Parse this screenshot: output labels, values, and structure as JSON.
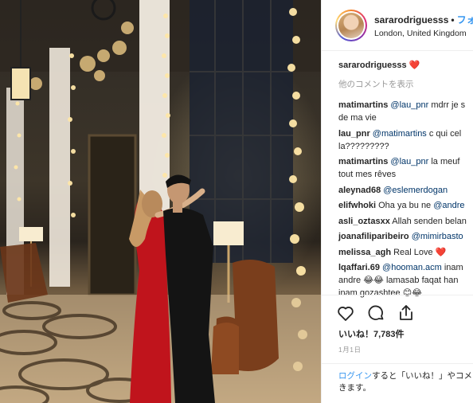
{
  "header": {
    "username": "sararodriguesss",
    "separator": "•",
    "follow_label": "フォ",
    "location": "London, United Kingdom"
  },
  "caption": {
    "username": "sararodriguesss",
    "text": "❤️"
  },
  "view_more_label": "他のコメントを表示",
  "comments": [
    {
      "username": "matimartins",
      "mention": "@lau_pnr",
      "text": " mdrr je s",
      "text2": "de ma vie"
    },
    {
      "username": "lau_pnr",
      "mention": "@matimartins",
      "text": " c qui cel",
      "text2": "la?????????"
    },
    {
      "username": "matimartins",
      "mention": "@lau_pnr",
      "text": " la meuf ",
      "text2": "tout mes rêves"
    },
    {
      "username": "aleynad68",
      "mention": "@eslemerdogan",
      "text": ""
    },
    {
      "username": "elifwhoki",
      "mention": "",
      "text": "Oha ya bu ne ",
      "mention2": "@andre"
    },
    {
      "username": "asli_oztasxx",
      "mention": "",
      "text": "Allah senden belan"
    },
    {
      "username": "joanafiliparibeiro",
      "mention": "@mimirbasto",
      "text": ""
    },
    {
      "username": "melissa_agh",
      "mention": "",
      "text": "Real Love ❤️"
    },
    {
      "username": "lqaffari.69",
      "mention": "@hooman.acm",
      "text": " inam",
      "text2": "andre 😂😂 lamasab faqat han",
      "text3": "inam gozashtee 😊😂"
    }
  ],
  "actions": {
    "like_icon": "heart-icon",
    "comment_icon": "comment-icon",
    "share_icon": "share-icon",
    "likes_text": "いいね！7,783件",
    "date_text": "1月1日"
  },
  "login": {
    "link": "ログイン",
    "text": "すると「いいね！」やコメ",
    "text2": "きます。"
  },
  "colors": {
    "link_blue": "#3897f0",
    "mention_blue": "#003569",
    "heart_red": "#ed4956",
    "dress_red": "#c0141c"
  }
}
